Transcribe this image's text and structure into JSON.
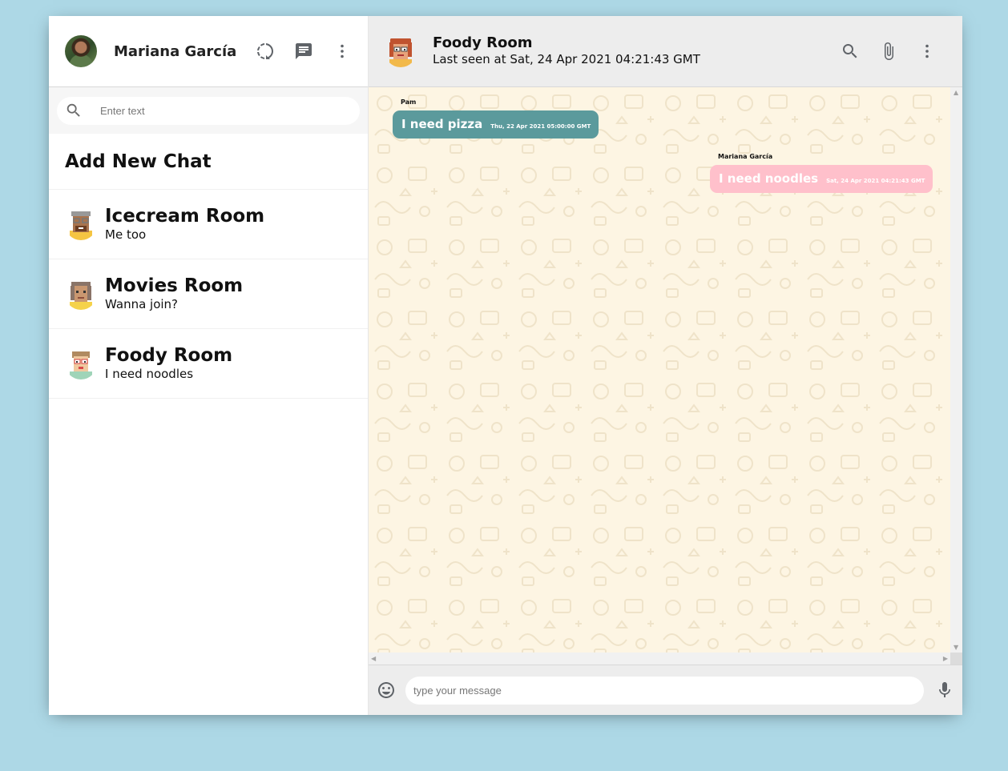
{
  "sidebar": {
    "user_name": "Mariana García",
    "search_placeholder": "Enter text",
    "add_chat_label": "Add New Chat",
    "chats": [
      {
        "title": "Icecream Room",
        "last_message": "Me too"
      },
      {
        "title": "Movies Room",
        "last_message": "Wanna join?"
      },
      {
        "title": "Foody Room",
        "last_message": "I need noodles"
      }
    ]
  },
  "chat": {
    "room_name": "Foody Room",
    "last_seen": "Last seen at Sat, 24 Apr 2021 04:21:43 GMT",
    "messages": [
      {
        "sender": "Pam",
        "text": "I need pizza",
        "timestamp": "Thu, 22 Apr 2021 05:00:00 GMT",
        "direction": "received"
      },
      {
        "sender": "Mariana García",
        "text": "I need noodles",
        "timestamp": "Sat, 24 Apr 2021 04:21:43 GMT",
        "direction": "sent"
      }
    ],
    "input_placeholder": "type your message"
  },
  "colors": {
    "page_background": "#add8e6",
    "received_bubble": "#5b9a9c",
    "sent_bubble": "#ffc0cb",
    "chat_background": "#fdf5e3",
    "header_background": "#ededed"
  },
  "icons": [
    "search-icon",
    "status-icon",
    "chat-icon",
    "more-vert-icon",
    "attach-icon",
    "emoji-icon",
    "mic-icon"
  ]
}
